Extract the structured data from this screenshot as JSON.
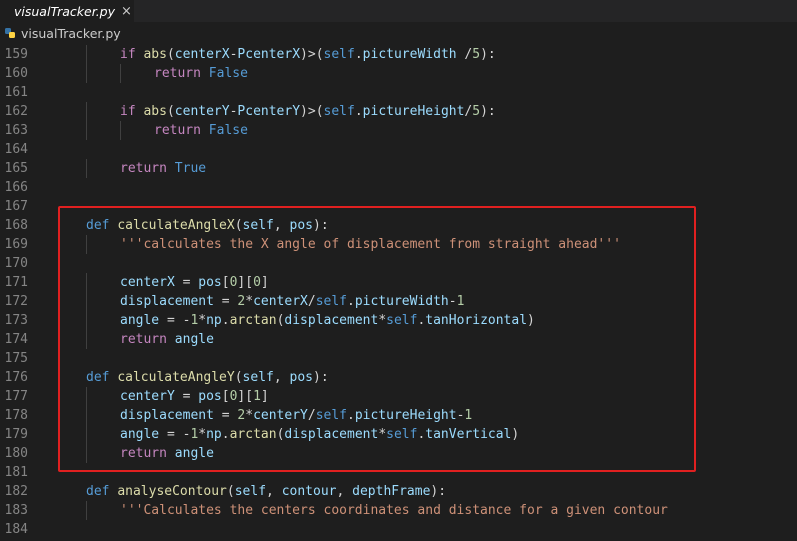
{
  "tab": {
    "title": "visualTracker.py",
    "close_symbol": "×"
  },
  "breadcrumb": {
    "file": "visualTracker.py"
  },
  "editor": {
    "lines": [
      {
        "n": "159",
        "i": 2,
        "tokens": [
          {
            "c": "ctl",
            "t": "if "
          },
          {
            "c": "fn",
            "t": "abs"
          },
          {
            "c": "op",
            "t": "("
          },
          {
            "c": "var",
            "t": "centerX"
          },
          {
            "c": "op",
            "t": "-"
          },
          {
            "c": "var",
            "t": "PcenterX"
          },
          {
            "c": "op",
            "t": ")>("
          },
          {
            "c": "self",
            "t": "self"
          },
          {
            "c": "op",
            "t": "."
          },
          {
            "c": "var",
            "t": "pictureWidth"
          },
          {
            "c": "op",
            "t": " /"
          },
          {
            "c": "num",
            "t": "5"
          },
          {
            "c": "op",
            "t": "):"
          }
        ]
      },
      {
        "n": "160",
        "i": 3,
        "tokens": [
          {
            "c": "ctl",
            "t": "return "
          },
          {
            "c": "kw",
            "t": "False"
          }
        ]
      },
      {
        "n": "161",
        "i": 0,
        "tokens": []
      },
      {
        "n": "162",
        "i": 2,
        "tokens": [
          {
            "c": "ctl",
            "t": "if "
          },
          {
            "c": "fn",
            "t": "abs"
          },
          {
            "c": "op",
            "t": "("
          },
          {
            "c": "var",
            "t": "centerY"
          },
          {
            "c": "op",
            "t": "-"
          },
          {
            "c": "var",
            "t": "PcenterY"
          },
          {
            "c": "op",
            "t": ")>("
          },
          {
            "c": "self",
            "t": "self"
          },
          {
            "c": "op",
            "t": "."
          },
          {
            "c": "var",
            "t": "pictureHeight"
          },
          {
            "c": "op",
            "t": "/"
          },
          {
            "c": "num",
            "t": "5"
          },
          {
            "c": "op",
            "t": "):"
          }
        ]
      },
      {
        "n": "163",
        "i": 3,
        "tokens": [
          {
            "c": "ctl",
            "t": "return "
          },
          {
            "c": "kw",
            "t": "False"
          }
        ]
      },
      {
        "n": "164",
        "i": 0,
        "tokens": []
      },
      {
        "n": "165",
        "i": 2,
        "tokens": [
          {
            "c": "ctl",
            "t": "return "
          },
          {
            "c": "kw",
            "t": "True"
          }
        ]
      },
      {
        "n": "166",
        "i": 0,
        "tokens": []
      },
      {
        "n": "167",
        "i": 0,
        "tokens": []
      },
      {
        "n": "168",
        "i": 1,
        "tokens": [
          {
            "c": "kw",
            "t": "def "
          },
          {
            "c": "fn",
            "t": "calculateAngleX"
          },
          {
            "c": "op",
            "t": "("
          },
          {
            "c": "var",
            "t": "self"
          },
          {
            "c": "op",
            "t": ", "
          },
          {
            "c": "var",
            "t": "pos"
          },
          {
            "c": "op",
            "t": "):"
          }
        ]
      },
      {
        "n": "169",
        "i": 2,
        "tokens": [
          {
            "c": "str",
            "t": "'''calculates the X angle of displacement from straight ahead'''"
          }
        ]
      },
      {
        "n": "170",
        "i": 0,
        "tokens": []
      },
      {
        "n": "171",
        "i": 2,
        "tokens": [
          {
            "c": "var",
            "t": "centerX"
          },
          {
            "c": "op",
            "t": " = "
          },
          {
            "c": "var",
            "t": "pos"
          },
          {
            "c": "op",
            "t": "["
          },
          {
            "c": "num",
            "t": "0"
          },
          {
            "c": "op",
            "t": "]["
          },
          {
            "c": "num",
            "t": "0"
          },
          {
            "c": "op",
            "t": "]"
          }
        ]
      },
      {
        "n": "172",
        "i": 2,
        "tokens": [
          {
            "c": "var",
            "t": "displacement"
          },
          {
            "c": "op",
            "t": " = "
          },
          {
            "c": "num",
            "t": "2"
          },
          {
            "c": "op",
            "t": "*"
          },
          {
            "c": "var",
            "t": "centerX"
          },
          {
            "c": "op",
            "t": "/"
          },
          {
            "c": "self",
            "t": "self"
          },
          {
            "c": "op",
            "t": "."
          },
          {
            "c": "var",
            "t": "pictureWidth"
          },
          {
            "c": "op",
            "t": "-"
          },
          {
            "c": "num",
            "t": "1"
          }
        ]
      },
      {
        "n": "173",
        "i": 2,
        "tokens": [
          {
            "c": "var",
            "t": "angle"
          },
          {
            "c": "op",
            "t": " = -"
          },
          {
            "c": "num",
            "t": "1"
          },
          {
            "c": "op",
            "t": "*"
          },
          {
            "c": "var",
            "t": "np"
          },
          {
            "c": "op",
            "t": "."
          },
          {
            "c": "fn",
            "t": "arctan"
          },
          {
            "c": "op",
            "t": "("
          },
          {
            "c": "var",
            "t": "displacement"
          },
          {
            "c": "op",
            "t": "*"
          },
          {
            "c": "self",
            "t": "self"
          },
          {
            "c": "op",
            "t": "."
          },
          {
            "c": "var",
            "t": "tanHorizontal"
          },
          {
            "c": "op",
            "t": ")"
          }
        ]
      },
      {
        "n": "174",
        "i": 2,
        "tokens": [
          {
            "c": "ctl",
            "t": "return "
          },
          {
            "c": "var",
            "t": "angle"
          }
        ]
      },
      {
        "n": "175",
        "i": 0,
        "tokens": []
      },
      {
        "n": "176",
        "i": 1,
        "tokens": [
          {
            "c": "kw",
            "t": "def "
          },
          {
            "c": "fn",
            "t": "calculateAngleY"
          },
          {
            "c": "op",
            "t": "("
          },
          {
            "c": "var",
            "t": "self"
          },
          {
            "c": "op",
            "t": ", "
          },
          {
            "c": "var",
            "t": "pos"
          },
          {
            "c": "op",
            "t": "):"
          }
        ]
      },
      {
        "n": "177",
        "i": 2,
        "tokens": [
          {
            "c": "var",
            "t": "centerY"
          },
          {
            "c": "op",
            "t": " = "
          },
          {
            "c": "var",
            "t": "pos"
          },
          {
            "c": "op",
            "t": "["
          },
          {
            "c": "num",
            "t": "0"
          },
          {
            "c": "op",
            "t": "]["
          },
          {
            "c": "num",
            "t": "1"
          },
          {
            "c": "op",
            "t": "]"
          }
        ]
      },
      {
        "n": "178",
        "i": 2,
        "tokens": [
          {
            "c": "var",
            "t": "displacement"
          },
          {
            "c": "op",
            "t": " = "
          },
          {
            "c": "num",
            "t": "2"
          },
          {
            "c": "op",
            "t": "*"
          },
          {
            "c": "var",
            "t": "centerY"
          },
          {
            "c": "op",
            "t": "/"
          },
          {
            "c": "self",
            "t": "self"
          },
          {
            "c": "op",
            "t": "."
          },
          {
            "c": "var",
            "t": "pictureHeight"
          },
          {
            "c": "op",
            "t": "-"
          },
          {
            "c": "num",
            "t": "1"
          }
        ]
      },
      {
        "n": "179",
        "i": 2,
        "tokens": [
          {
            "c": "var",
            "t": "angle"
          },
          {
            "c": "op",
            "t": " = -"
          },
          {
            "c": "num",
            "t": "1"
          },
          {
            "c": "op",
            "t": "*"
          },
          {
            "c": "var",
            "t": "np"
          },
          {
            "c": "op",
            "t": "."
          },
          {
            "c": "fn",
            "t": "arctan"
          },
          {
            "c": "op",
            "t": "("
          },
          {
            "c": "var",
            "t": "displacement"
          },
          {
            "c": "op",
            "t": "*"
          },
          {
            "c": "self",
            "t": "self"
          },
          {
            "c": "op",
            "t": "."
          },
          {
            "c": "var",
            "t": "tanVertical"
          },
          {
            "c": "op",
            "t": ")"
          }
        ]
      },
      {
        "n": "180",
        "i": 2,
        "tokens": [
          {
            "c": "ctl",
            "t": "return "
          },
          {
            "c": "var",
            "t": "angle"
          }
        ]
      },
      {
        "n": "181",
        "i": 0,
        "tokens": []
      },
      {
        "n": "182",
        "i": 1,
        "tokens": [
          {
            "c": "kw",
            "t": "def "
          },
          {
            "c": "fn",
            "t": "analyseContour"
          },
          {
            "c": "op",
            "t": "("
          },
          {
            "c": "var",
            "t": "self"
          },
          {
            "c": "op",
            "t": ", "
          },
          {
            "c": "var",
            "t": "contour"
          },
          {
            "c": "op",
            "t": ", "
          },
          {
            "c": "var",
            "t": "depthFrame"
          },
          {
            "c": "op",
            "t": "):"
          }
        ]
      },
      {
        "n": "183",
        "i": 2,
        "tokens": [
          {
            "c": "str",
            "t": "'''Calculates the centers coordinates and distance for a given contour"
          }
        ]
      },
      {
        "n": "184",
        "i": 0,
        "tokens": []
      }
    ]
  },
  "colors": {
    "background": "#1e1e1e",
    "highlight_box": "#e02020",
    "python_icon_blue": "#3572a5",
    "python_icon_yellow": "#ffd343"
  }
}
